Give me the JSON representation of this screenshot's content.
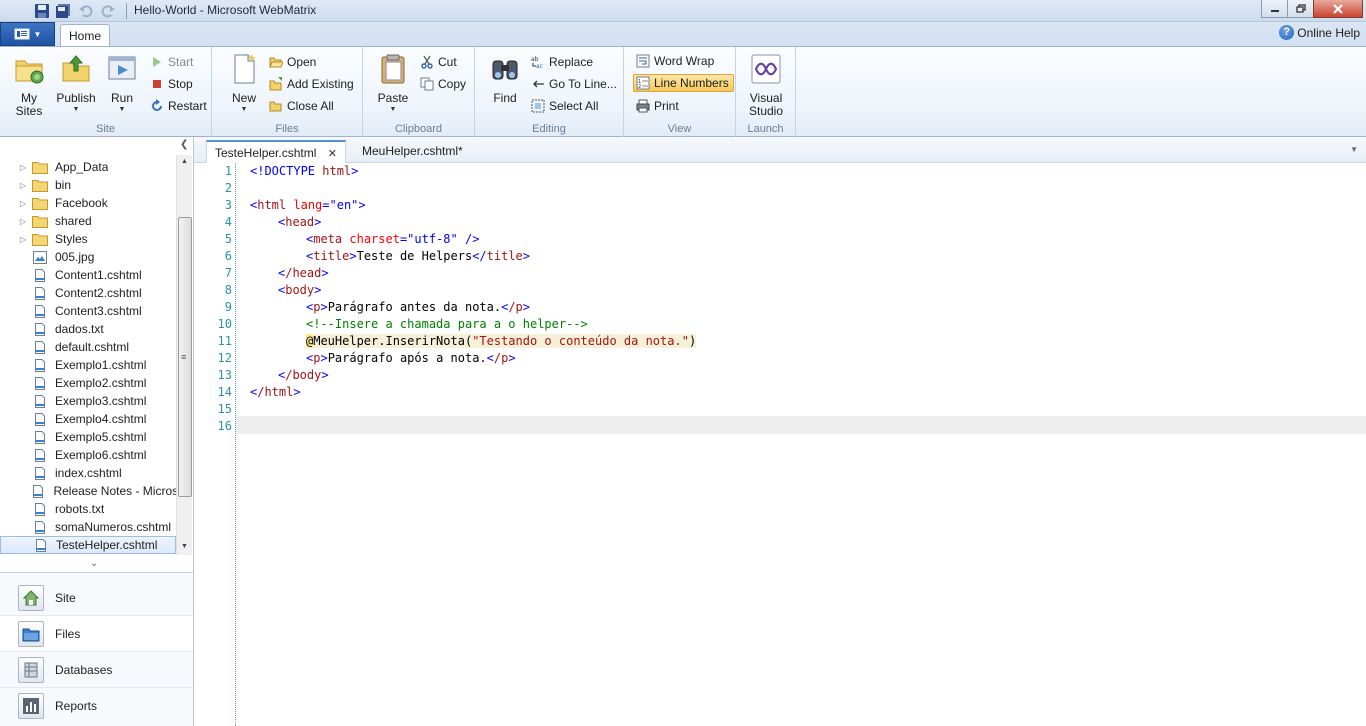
{
  "window": {
    "title": "Hello-World - Microsoft WebMatrix"
  },
  "ribbon": {
    "tab_home": "Home",
    "online_help": "Online Help",
    "groups": {
      "site": {
        "label": "Site",
        "my_sites_l1": "My",
        "my_sites_l2": "Sites",
        "publish": "Publish",
        "run": "Run",
        "start": "Start",
        "stop": "Stop",
        "restart": "Restart"
      },
      "files": {
        "label": "Files",
        "new": "New",
        "open": "Open",
        "add_existing": "Add Existing",
        "close_all": "Close All"
      },
      "clipboard": {
        "label": "Clipboard",
        "paste": "Paste",
        "cut": "Cut",
        "copy": "Copy"
      },
      "editing": {
        "label": "Editing",
        "find": "Find",
        "replace": "Replace",
        "go_to_line": "Go To Line...",
        "select_all": "Select All"
      },
      "view": {
        "label": "View",
        "word_wrap": "Word Wrap",
        "line_numbers": "Line Numbers",
        "print": "Print"
      },
      "launch": {
        "label": "Launch",
        "visual_studio_l1": "Visual",
        "visual_studio_l2": "Studio"
      }
    }
  },
  "file_tree": {
    "items": [
      {
        "label": "App_Data",
        "type": "folder"
      },
      {
        "label": "bin",
        "type": "folder"
      },
      {
        "label": "Facebook",
        "type": "folder"
      },
      {
        "label": "shared",
        "type": "folder"
      },
      {
        "label": "Styles",
        "type": "folder"
      },
      {
        "label": "005.jpg",
        "type": "image"
      },
      {
        "label": "Content1.cshtml",
        "type": "file"
      },
      {
        "label": "Content2.cshtml",
        "type": "file"
      },
      {
        "label": "Content3.cshtml",
        "type": "file"
      },
      {
        "label": "dados.txt",
        "type": "file"
      },
      {
        "label": "default.cshtml",
        "type": "file"
      },
      {
        "label": "Exemplo1.cshtml",
        "type": "file"
      },
      {
        "label": "Exemplo2.cshtml",
        "type": "file"
      },
      {
        "label": "Exemplo3.cshtml",
        "type": "file"
      },
      {
        "label": "Exemplo4.cshtml",
        "type": "file"
      },
      {
        "label": "Exemplo5.cshtml",
        "type": "file"
      },
      {
        "label": "Exemplo6.cshtml",
        "type": "file"
      },
      {
        "label": "index.cshtml",
        "type": "file"
      },
      {
        "label": "Release Notes - Microsoft",
        "type": "file"
      },
      {
        "label": "robots.txt",
        "type": "file"
      },
      {
        "label": "somaNumeros.cshtml",
        "type": "file"
      },
      {
        "label": "TesteHelper.cshtml",
        "type": "file",
        "selected": true
      }
    ]
  },
  "workspaces": {
    "site": "Site",
    "files": "Files",
    "databases": "Databases",
    "reports": "Reports"
  },
  "editor": {
    "tabs": [
      {
        "label": "TesteHelper.cshtml",
        "active": true
      },
      {
        "label": "MeuHelper.cshtml*",
        "active": false
      }
    ],
    "current_line": 16,
    "line_numbers": [
      "1",
      "2",
      "3",
      "4",
      "5",
      "6",
      "7",
      "8",
      "9",
      "10",
      "11",
      "12",
      "13",
      "14",
      "15",
      "16"
    ],
    "code": {
      "l1_bracket": "<!DOCTYPE",
      "l1_html": " html",
      "l1_end": ">",
      "l3_open": "<",
      "l3_tag": "html",
      "l3_attr": " lang",
      "l3_eq": "=",
      "l3_val": "\"en\"",
      "l3_close": ">",
      "l4_tag": "head",
      "l5_tag": "meta",
      "l5_attr": " charset",
      "l5_val": "\"utf-8\"",
      "l5_close": " />",
      "l6_tag": "title",
      "l6_text": "Teste de Helpers",
      "l7_tag": "/head",
      "l8_tag": "body",
      "l9_tag": "p",
      "l9_text": "Parágrafo antes da nota.",
      "l9_end": "/p",
      "l10_comment": "<!--Insere a chamada para a o helper-->",
      "l11_at": "@",
      "l11_call": "MeuHelper.InserirNota(",
      "l11_str": "\"Testando o conteúdo da nota.\"",
      "l11_end": ")",
      "l12_text": "Parágrafo após a nota.",
      "l13_tag": "/body",
      "l14_tag": "/html"
    }
  }
}
